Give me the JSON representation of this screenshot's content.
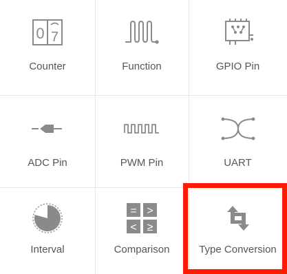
{
  "tiles": [
    {
      "id": "counter",
      "label": "Counter",
      "icon": "counter-icon",
      "digits": [
        "0",
        "7"
      ]
    },
    {
      "id": "function",
      "label": "Function",
      "icon": "function-icon"
    },
    {
      "id": "gpio",
      "label": "GPIO Pin",
      "icon": "gpio-pin-icon"
    },
    {
      "id": "adc",
      "label": "ADC Pin",
      "icon": "adc-pin-icon"
    },
    {
      "id": "pwm",
      "label": "PWM Pin",
      "icon": "pwm-pin-icon"
    },
    {
      "id": "uart",
      "label": "UART",
      "icon": "uart-icon"
    },
    {
      "id": "interval",
      "label": "Interval",
      "icon": "interval-icon"
    },
    {
      "id": "comparison",
      "label": "Comparison",
      "icon": "comparison-icon",
      "symbols": [
        "=",
        ">",
        "<",
        "≥"
      ]
    },
    {
      "id": "type_conversion",
      "label": "Type Conversion",
      "icon": "type-conversion-icon",
      "selected": true
    }
  ],
  "colors": {
    "icon": "#8a8a8a",
    "label": "#555555",
    "grid": "#e6e6e6",
    "highlight": "#ff1a00"
  }
}
